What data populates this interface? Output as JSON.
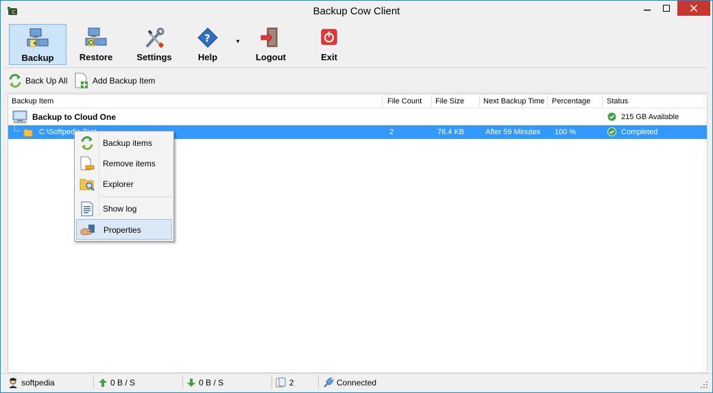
{
  "window": {
    "title": "Backup Cow Client"
  },
  "toolbar": {
    "backup": "Backup",
    "restore": "Restore",
    "settings": "Settings",
    "help": "Help",
    "logout": "Logout",
    "exit": "Exit"
  },
  "toolbar2": {
    "backup_all": "Back Up All",
    "add_item": "Add Backup Item"
  },
  "grid": {
    "columns": [
      "Backup Item",
      "File Count",
      "File Size",
      "Next Backup Time",
      "Percentage",
      "Status"
    ],
    "group": {
      "name": "Backup to Cloud One",
      "status": "215 GB Available"
    },
    "rows": [
      {
        "path": "C:\\Softpedia Test",
        "file_count": "2",
        "file_size": "76.4 KB",
        "next_backup": "After 59 Minutes",
        "percentage": "100 %",
        "status": "Completed"
      }
    ]
  },
  "context_menu": {
    "items": [
      "Backup items",
      "Remove items",
      "Explorer",
      "Show log",
      "Properties"
    ]
  },
  "statusbar": {
    "user": "softpedia",
    "upload": "0 B / S",
    "download": "0 B / S",
    "count": "2",
    "connection": "Connected"
  },
  "colors": {
    "selection": "#3399ff",
    "close": "#c7372f",
    "accent": "#1a8ad0"
  }
}
